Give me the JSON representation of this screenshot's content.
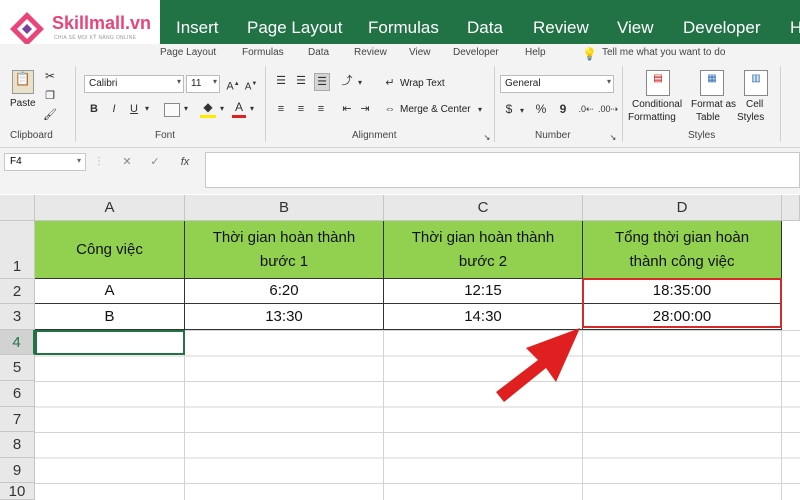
{
  "logo": {
    "name": "Skillmall.vn",
    "tagline": "CHIA SẺ MỌI KỸ NĂNG ONLINE"
  },
  "ribbon_tabs": [
    "Insert",
    "Page Layout",
    "Formulas",
    "Data",
    "Review",
    "View",
    "Developer",
    "H"
  ],
  "sub_tabs": [
    "Page Layout",
    "Formulas",
    "Data",
    "Review",
    "View",
    "Developer",
    "Help"
  ],
  "tell_me": "Tell me what you want to do",
  "clipboard": {
    "paste": "Paste",
    "group": "Clipboard"
  },
  "font": {
    "family": "Calibri",
    "size": "11",
    "bold": "B",
    "italic": "I",
    "underline": "U",
    "group": "Font"
  },
  "alignment": {
    "wrap_text": "Wrap Text",
    "merge_center": "Merge & Center",
    "group": "Alignment"
  },
  "number": {
    "format": "General",
    "currency": "$",
    "percent": "%",
    "comma": "9",
    "group": "Number"
  },
  "styles": {
    "conditional": [
      "Conditional",
      "Formatting"
    ],
    "format_as": [
      "Format as",
      "Table"
    ],
    "cell": [
      "Cell",
      "Styles"
    ],
    "group": "Styles"
  },
  "formula_bar": {
    "name_box": "F4",
    "cancel": "✕",
    "enter": "✓",
    "fx": "fx",
    "value": ""
  },
  "columns": [
    "A",
    "B",
    "C",
    "D"
  ],
  "rows": [
    "1",
    "2",
    "3",
    "4",
    "5",
    "6",
    "7",
    "8",
    "9",
    "10"
  ],
  "table": {
    "headers": [
      [
        "Công việc"
      ],
      [
        "Thời gian hoàn thành",
        "bước 1"
      ],
      [
        "Thời gian hoàn thành",
        "bước 2"
      ],
      [
        "Tổng thời gian hoàn",
        "thành công việc"
      ]
    ],
    "rows": [
      [
        "A",
        "6:20",
        "12:15",
        "18:35:00"
      ],
      [
        "B",
        "13:30",
        "14:30",
        "28:00:00"
      ]
    ]
  },
  "colors": {
    "excel_green": "#217346",
    "header_fill": "#92d050",
    "highlight": "#d42a2a",
    "arrow": "#e02020",
    "brand_pink": "#e8457a"
  }
}
